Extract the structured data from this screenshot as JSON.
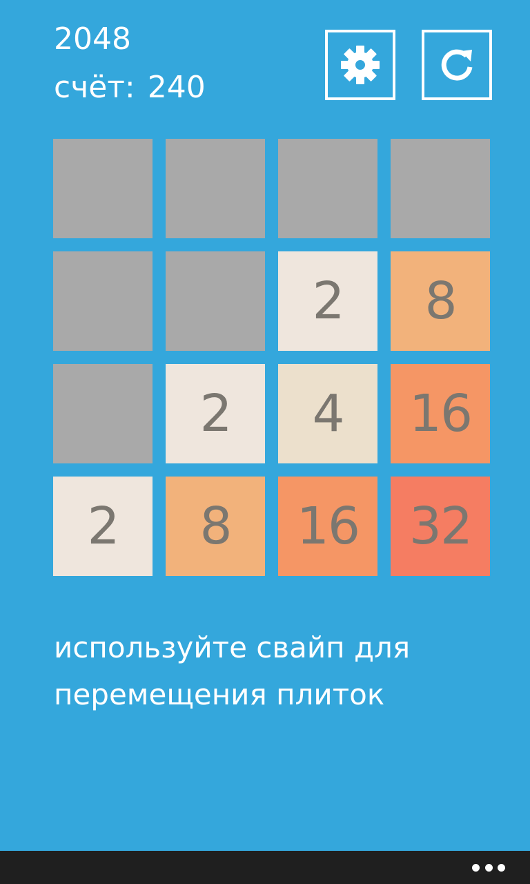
{
  "header": {
    "title": "2048",
    "score_label": "счёт:",
    "score_value": "240"
  },
  "toolbar": {
    "settings_icon": "gear-icon",
    "restart_icon": "refresh-icon"
  },
  "board": {
    "rows": [
      [
        "",
        "",
        "",
        ""
      ],
      [
        "",
        "",
        "2",
        "8"
      ],
      [
        "",
        "2",
        "4",
        "16"
      ],
      [
        "2",
        "8",
        "16",
        "32"
      ]
    ],
    "colors": {
      "empty": "#a9a9a9",
      "2": "#efe6dd",
      "4": "#ece0cc",
      "8": "#f2b27b",
      "16": "#f59665",
      "32": "#f57d62"
    }
  },
  "hint": {
    "text": "используйте свайп для перемещения плиток"
  },
  "app_bar": {
    "more_icon": "ellipsis-icon"
  },
  "colors": {
    "background": "#34a7dc",
    "tile_text": "#7b7770",
    "app_bar": "#1f1f1f"
  }
}
